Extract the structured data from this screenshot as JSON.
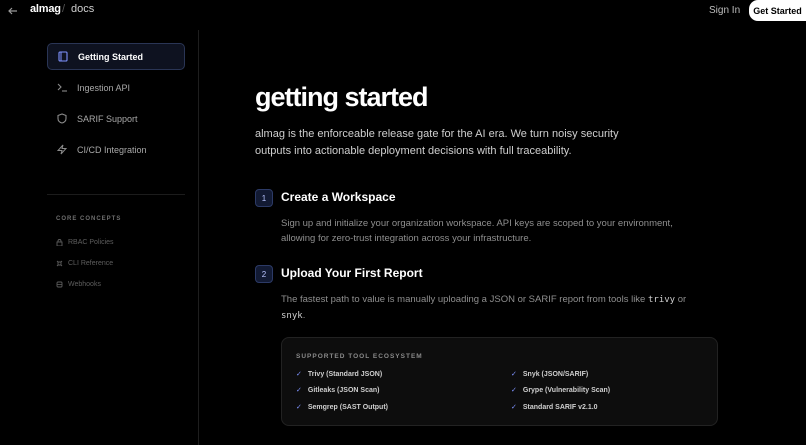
{
  "header": {
    "back_icon": "arrow-left-icon",
    "brand": "almag",
    "separator": "/",
    "section": "docs",
    "sign_in": "Sign In",
    "get_started": "Get Started"
  },
  "sidebar": {
    "items": [
      {
        "label": "Getting Started",
        "icon": "book-icon",
        "active": true
      },
      {
        "label": "Ingestion API",
        "icon": "terminal-icon",
        "active": false
      },
      {
        "label": "SARIF Support",
        "icon": "shield-icon",
        "active": false
      },
      {
        "label": "CI/CD Integration",
        "icon": "lightning-icon",
        "active": false
      }
    ],
    "core_concepts_title": "CORE CONCEPTS",
    "core_concepts": [
      {
        "label": "RBAC Policies",
        "icon": "lock-icon"
      },
      {
        "label": "CLI Reference",
        "icon": "command-icon"
      },
      {
        "label": "Webhooks",
        "icon": "webhook-icon"
      }
    ]
  },
  "main": {
    "title": "getting started",
    "lead": "almag is the enforceable release gate for the AI era. We turn noisy security outputs into actionable deployment decisions with full traceability.",
    "steps": [
      {
        "number": "1",
        "title": "Create a Workspace",
        "body": "Sign up and initialize your organization workspace. API keys are scoped to your environment, allowing for zero-trust integration across your infrastructure."
      },
      {
        "number": "2",
        "title": "Upload Your First Report",
        "body_prefix": "The fastest path to value is manually uploading a JSON or SARIF report from tools like ",
        "code1": "trivy",
        "body_mid": " or ",
        "code2": "snyk",
        "body_suffix": "."
      }
    ],
    "ecosystem": {
      "title": "SUPPORTED TOOL ECOSYSTEM",
      "tools": [
        "Trivy (Standard JSON)",
        "Snyk (JSON/SARIF)",
        "Gitleaks (JSON Scan)",
        "Grype (Vulnerability Scan)",
        "Semgrep (SAST Output)",
        "Standard SARIF v2.1.0"
      ]
    }
  },
  "colors": {
    "background": "#000000",
    "accent": "#7f93ff",
    "active_nav_bg": "#0e1220"
  }
}
